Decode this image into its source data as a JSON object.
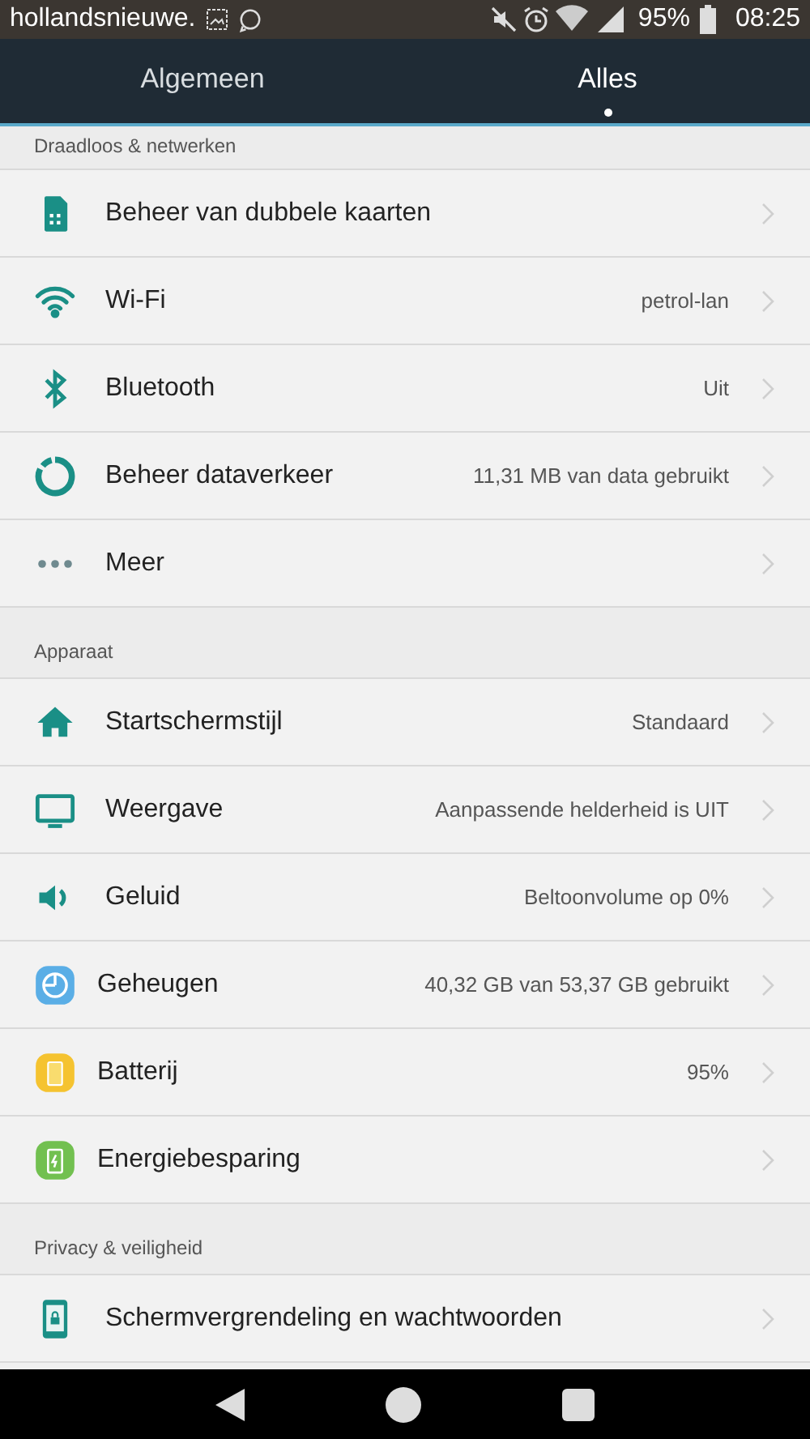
{
  "status_bar": {
    "carrier": "hollandsnieuwe.",
    "battery": "95%",
    "time": "08:25"
  },
  "tabs": [
    {
      "label": "Algemeen",
      "selected": false
    },
    {
      "label": "Alles",
      "selected": true
    }
  ],
  "sections": [
    {
      "title": "Draadloos & netwerken",
      "items": [
        {
          "kind": "sim",
          "label": "Beheer van dubbele kaarten"
        },
        {
          "kind": "wifi",
          "label": "Wi-Fi",
          "value": "petrol-lan"
        },
        {
          "kind": "bluetooth",
          "label": "Bluetooth",
          "value": "Uit"
        },
        {
          "kind": "data",
          "label": "Beheer dataverkeer",
          "value": "11,31 MB van data gebruikt"
        },
        {
          "kind": "more",
          "label": "Meer"
        }
      ]
    },
    {
      "title": "Apparaat",
      "items": [
        {
          "kind": "home",
          "label": "Startschermstijl",
          "value": "Standaard"
        },
        {
          "kind": "display",
          "label": "Weergave",
          "value": "Aanpassende helderheid is UIT"
        },
        {
          "kind": "sound",
          "label": "Geluid",
          "value": "Beltoonvolume op 0%"
        },
        {
          "kind": "storage",
          "label": "Geheugen",
          "value": "40,32 GB van 53,37 GB gebruikt"
        },
        {
          "kind": "battery",
          "label": "Batterij",
          "value": "95%"
        },
        {
          "kind": "saving",
          "label": "Energiebesparing"
        }
      ]
    },
    {
      "title": "Privacy & veiligheid",
      "items": [
        {
          "kind": "lock",
          "label": "Schermvergrendeling en wachtwoorden"
        }
      ]
    }
  ]
}
